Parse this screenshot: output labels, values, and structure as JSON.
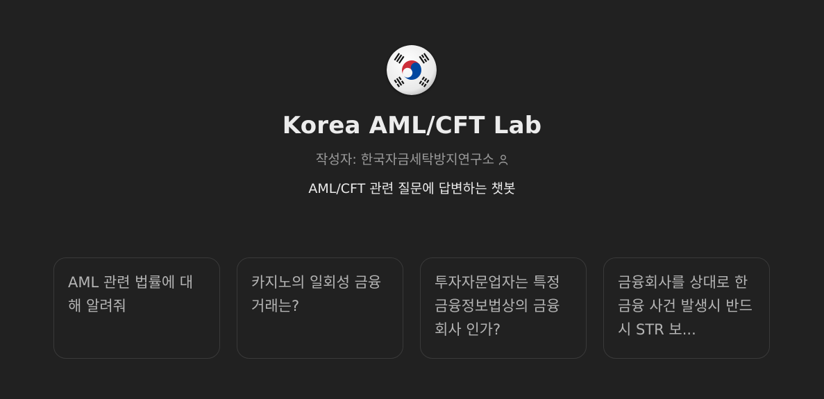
{
  "gpt": {
    "avatar_icon": "korea-flag-icon",
    "name": "Korea AML/CFT Lab",
    "author_prefix": "작성자: ",
    "author_name": "한국자금세탁방지연구소",
    "author_icon": "person-icon",
    "description": "AML/CFT 관련 질문에 답변하는 챗봇"
  },
  "starters": [
    {
      "text": "AML 관련 법률에 대해 알려줘"
    },
    {
      "text": "카지노의 일회성 금융거래는?"
    },
    {
      "text": "투자자문업자는 특정금융정보법상의 금융회사 인가?"
    },
    {
      "text": "금융회사를 상대로 한 금융 사건 발생시 반드시 STR 보..."
    }
  ],
  "colors": {
    "background": "#212121",
    "title": "#ececec",
    "muted": "#9b9b9b",
    "card_border": "#3a3a3a",
    "card_text": "#b4b4b4",
    "flag_red": "#cd2e3a",
    "flag_blue": "#0047a0"
  }
}
